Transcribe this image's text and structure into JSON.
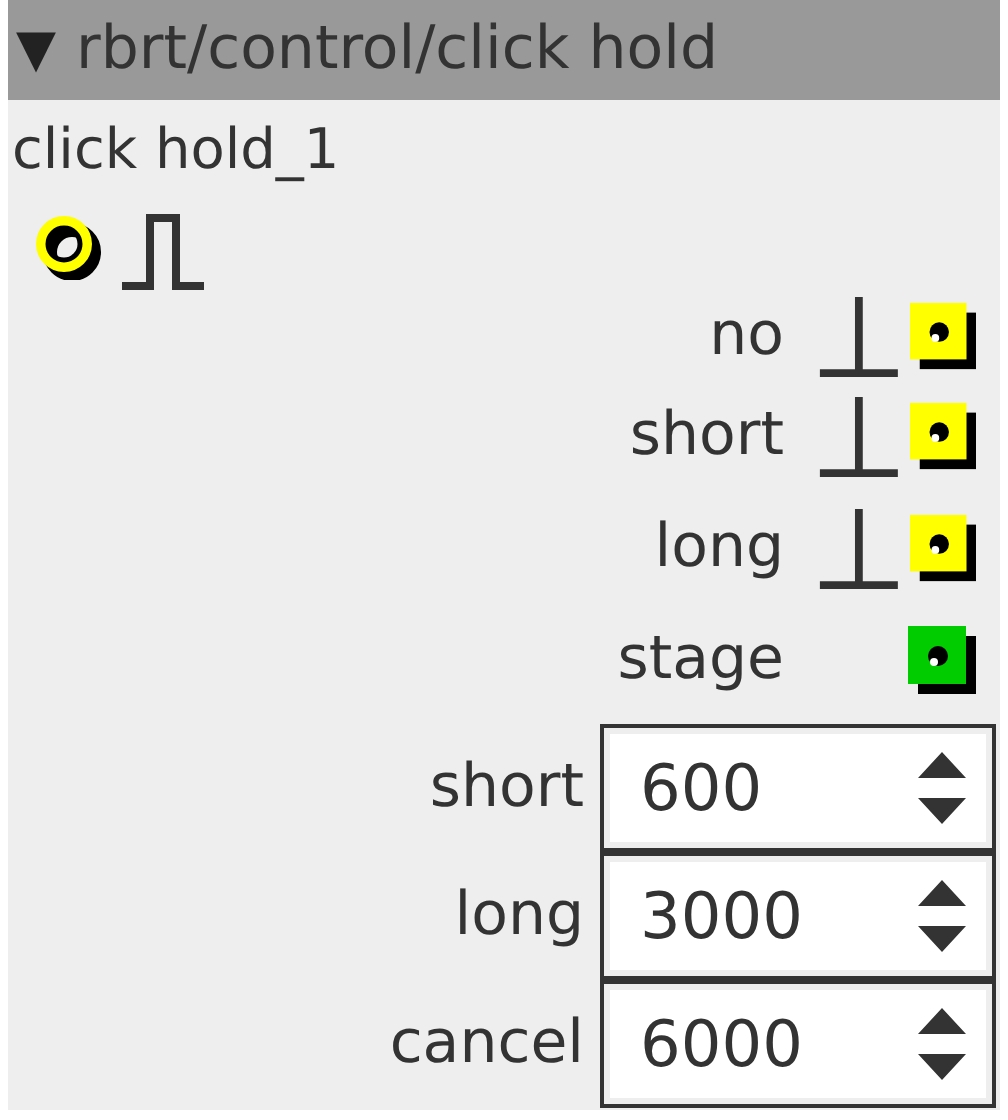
{
  "node": {
    "toggle": "▼",
    "title": "rbrt/control/click hold",
    "instance": "click hold_1"
  },
  "outputs": [
    {
      "label": "no",
      "kind": "trigger",
      "color": "#ffff00"
    },
    {
      "label": "short",
      "kind": "trigger",
      "color": "#ffff00"
    },
    {
      "label": "long",
      "kind": "trigger",
      "color": "#ffff00"
    },
    {
      "label": "stage",
      "kind": "value",
      "color": "#00cc00"
    }
  ],
  "params": [
    {
      "label": "short",
      "value": "600"
    },
    {
      "label": "long",
      "value": "3000"
    },
    {
      "label": "cancel",
      "value": "6000"
    }
  ]
}
